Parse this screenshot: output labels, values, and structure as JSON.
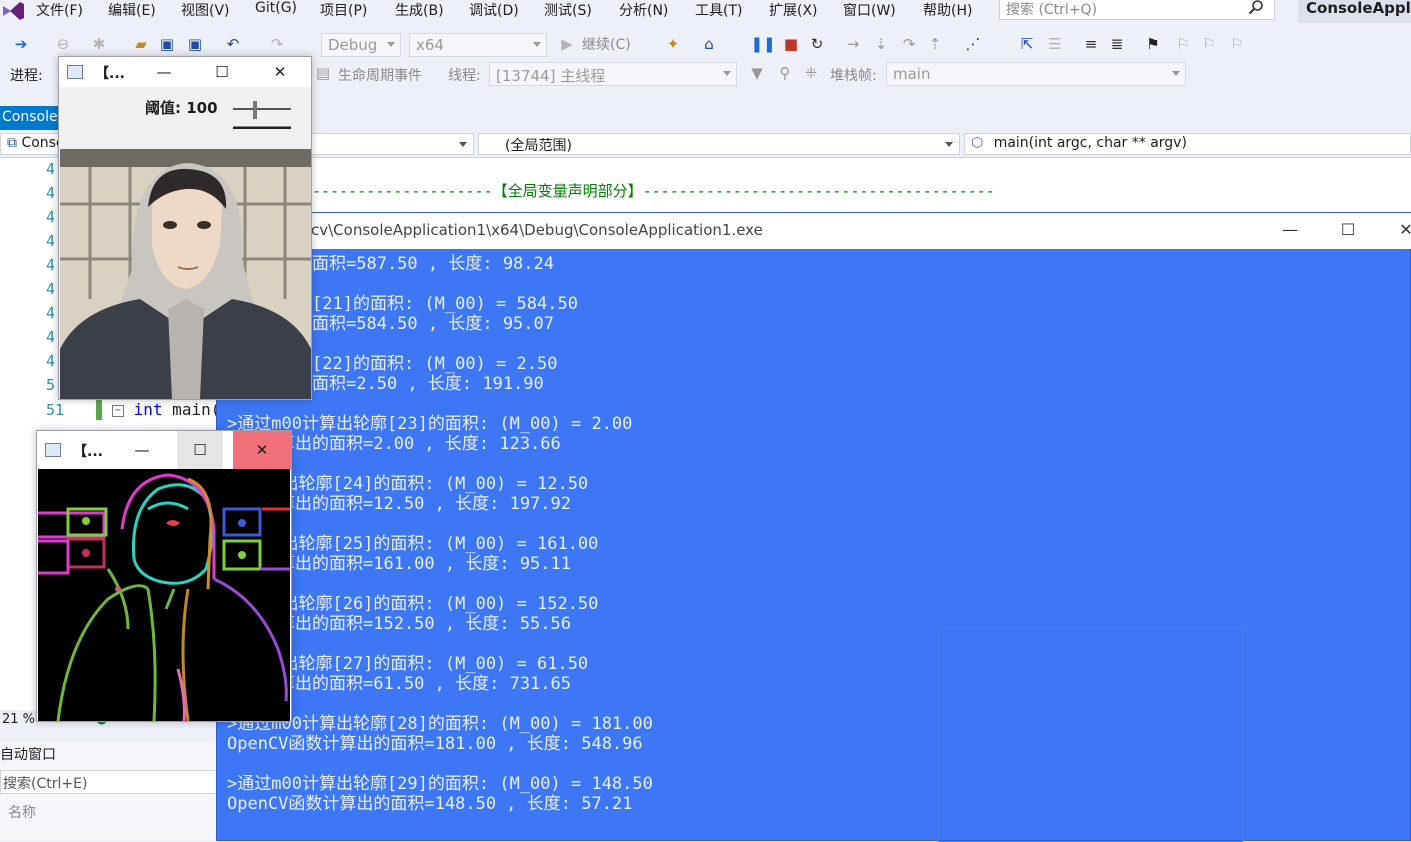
{
  "menu": {
    "items": [
      "文件(F)",
      "编辑(E)",
      "视图(V)",
      "Git(G)",
      "项目(P)",
      "生成(B)",
      "调试(D)",
      "测试(S)",
      "分析(N)",
      "工具(T)",
      "扩展(X)",
      "窗口(W)",
      "帮助(H)"
    ],
    "search_placeholder": "搜索 (Ctrl+Q)",
    "solution_title": "ConsoleApplic"
  },
  "toolbar": {
    "config": "Debug",
    "platform": "x64",
    "continue_label": "继续(C)"
  },
  "debug_bar": {
    "process_label": "进程:",
    "lifecycle_label": "生命周期事件",
    "thread_label": "线程:",
    "thread_value": "[13744] 主线程",
    "stack_label": "堆栈帧:",
    "stack_value": "main"
  },
  "editor": {
    "tab_label": "ConsoleA",
    "nav_project": "Conso",
    "nav_scope": "(全局范围)",
    "nav_function": "main(int argc, char ** argv)",
    "line_numbers": [
      "4",
      "4",
      "4",
      "4",
      "4",
      "4",
      "4",
      "4",
      "4",
      "5",
      "51"
    ],
    "comment_line": "--------------------【全局变量声明部分】---------------------------------------",
    "code_keyword": "int",
    "code_rest": " main("
  },
  "status": {
    "zoom": "21 %"
  },
  "auto_window": {
    "title": "自动窗口",
    "search_placeholder": "搜索(Ctrl+E)",
    "column_name": "名称"
  },
  "console": {
    "title": "cv\\ConsoleApplication1\\x64\\Debug\\ConsoleApplication1.exe",
    "lines": [
      "数计算出的面积=587.50 , 长度: 98.24",
      "",
      "计算出轮廓[21]的面积: (M_00) = 584.50",
      "数计算出的面积=584.50 , 长度: 95.07",
      "",
      "计算出轮廓[22]的面积: (M_00) = 2.50",
      "数计算出的面积=2.50 , 长度: 191.90",
      "",
      ">通过m00计算出轮廓[23]的面积: (M_00) = 2.00",
      "函数计算出的面积=2.00 , 长度: 123.66",
      "",
      "00计算出轮廓[24]的面积: (M_00) = 12.50",
      "函数计算出的面积=12.50 , 长度: 197.92",
      "",
      "00计算出轮廓[25]的面积: (M_00) = 161.00",
      "函数计算出的面积=161.00 , 长度: 95.11",
      "",
      "00计算出轮廓[26]的面积: (M_00) = 152.50",
      "函数计算出的面积=152.50 , 长度: 55.56",
      "",
      "00计算出轮廓[27]的面积: (M_00) = 61.50",
      "函数计算出的面积=61.50 , 长度: 731.65",
      "",
      ">通过m00计算出轮廓[28]的面积: (M_00) = 181.00",
      "OpenCV函数计算出的面积=181.00 , 长度: 548.96",
      "",
      ">通过m00计算出轮廓[29]的面积: (M_00) = 148.50",
      "OpenCV函数计算出的面积=148.50 , 长度: 57.21"
    ]
  },
  "cv_window_1": {
    "title": "【...",
    "trackbar_label": "阈值: 100",
    "trackbar_value": 100
  },
  "cv_window_2": {
    "title": "【..."
  },
  "colors": {
    "console_bg": "#3d77f6",
    "accent": "#007acc",
    "close_hover": "#e81123"
  }
}
